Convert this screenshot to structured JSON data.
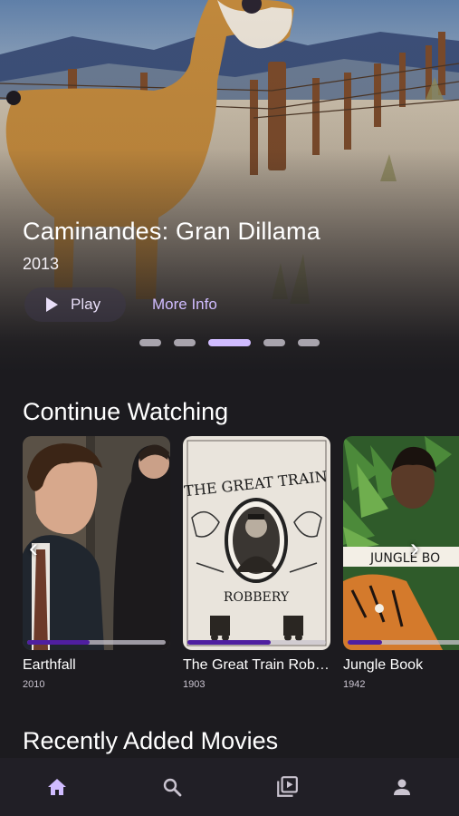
{
  "hero": {
    "title": "Caminandes: Gran Dillama",
    "year": "2013",
    "play_label": "Play",
    "more_info_label": "More Info",
    "carousel_count": 5,
    "carousel_active_index": 2
  },
  "continue_watching": {
    "title": "Continue Watching",
    "items": [
      {
        "title": "Earthfall",
        "year": "2010",
        "progress": 0.45
      },
      {
        "title": "The Great Train Rob…",
        "year": "1903",
        "progress": 0.6
      },
      {
        "title": "Jungle Book",
        "year": "1942",
        "progress": 0.25
      }
    ],
    "poster_text": {
      "train_top": "THE GREAT TRAIN",
      "train_bottom": "ROBBERY",
      "jungle_banner": "JUNGLE BO"
    },
    "prev_arrow": "‹",
    "next_arrow": "›"
  },
  "recently_added": {
    "title": "Recently Added Movies"
  },
  "nav": {
    "items": [
      {
        "icon": "home-icon",
        "active": true
      },
      {
        "icon": "search-icon",
        "active": false
      },
      {
        "icon": "library-icon",
        "active": false
      },
      {
        "icon": "person-icon",
        "active": false
      }
    ]
  },
  "colors": {
    "background": "#1c1b1f",
    "accent": "#d0bcff",
    "progress": "#4f1fa0",
    "nav_active": "#d0bcff",
    "nav_inactive": "#cac4d0"
  }
}
